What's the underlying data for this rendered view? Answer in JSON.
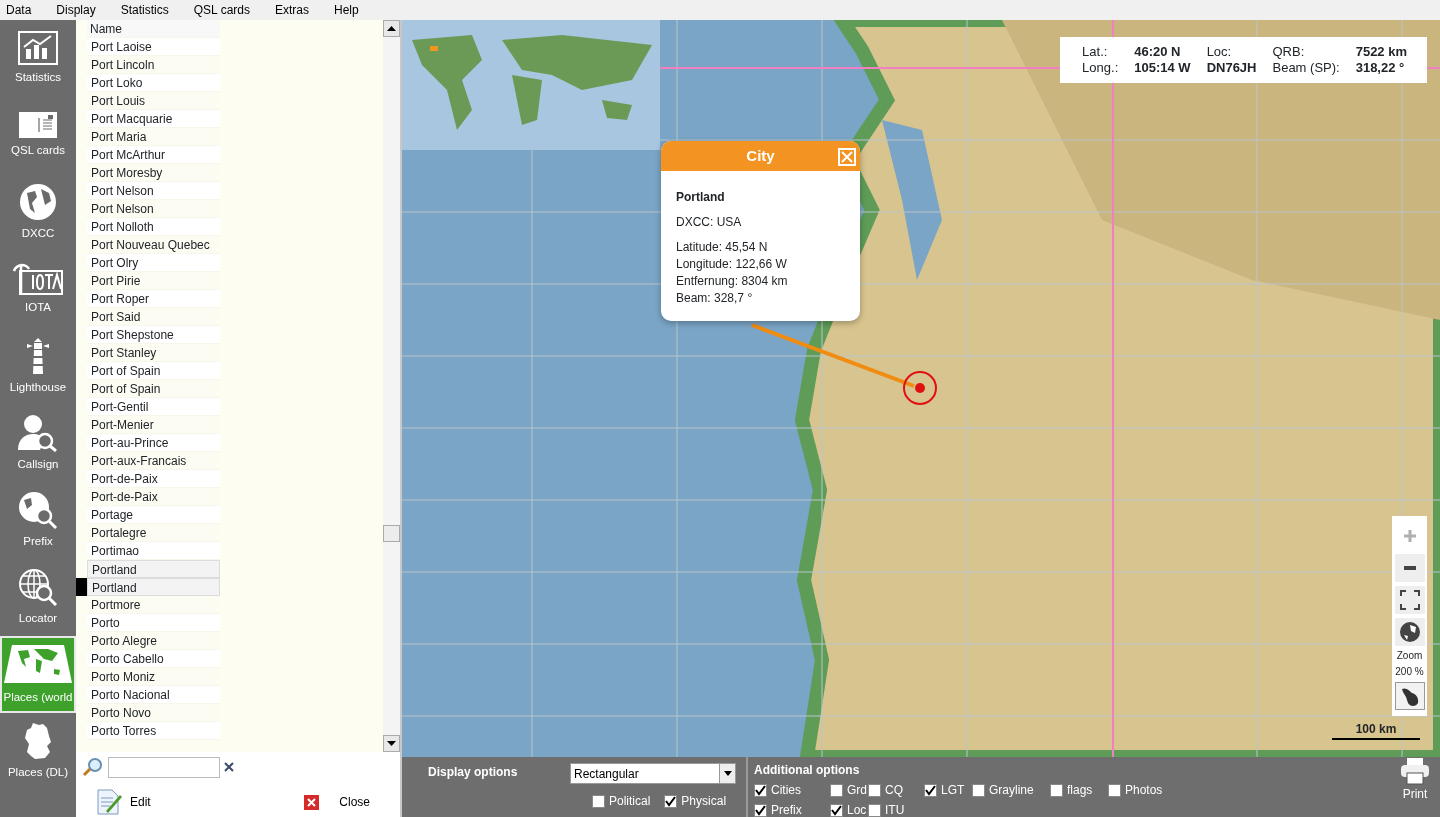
{
  "menu": [
    "Data",
    "Display",
    "Statistics",
    "QSL cards",
    "Extras",
    "Help"
  ],
  "sidebar": [
    {
      "label": "Statistics",
      "kind": "chart",
      "selected": false
    },
    {
      "label": "QSL cards",
      "kind": "card",
      "selected": false
    },
    {
      "label": "DXCC",
      "kind": "globe",
      "selected": false
    },
    {
      "label": "IOTA",
      "kind": "iota",
      "selected": false
    },
    {
      "label": "Lighthouse",
      "kind": "lighthouse",
      "selected": false
    },
    {
      "label": "Callsign",
      "kind": "person",
      "selected": false
    },
    {
      "label": "Prefix",
      "kind": "globe-search",
      "selected": false
    },
    {
      "label": "Locator",
      "kind": "grid-search",
      "selected": false
    },
    {
      "label": "Places (world",
      "kind": "map",
      "selected": true
    },
    {
      "label": "Places (DL)",
      "kind": "germany",
      "selected": false
    }
  ],
  "places_list": {
    "column": "Name",
    "items": [
      {
        "name": "Port Laoise",
        "selected": false,
        "highlighted": false
      },
      {
        "name": "Port Lincoln",
        "selected": false,
        "highlighted": false
      },
      {
        "name": "Port Loko",
        "selected": false,
        "highlighted": false
      },
      {
        "name": "Port Louis",
        "selected": false,
        "highlighted": false
      },
      {
        "name": "Port Macquarie",
        "selected": false,
        "highlighted": false
      },
      {
        "name": "Port Maria",
        "selected": false,
        "highlighted": false
      },
      {
        "name": "Port McArthur",
        "selected": false,
        "highlighted": false
      },
      {
        "name": "Port Moresby",
        "selected": false,
        "highlighted": false
      },
      {
        "name": "Port Nelson",
        "selected": false,
        "highlighted": false
      },
      {
        "name": "Port Nelson",
        "selected": false,
        "highlighted": false
      },
      {
        "name": "Port Nolloth",
        "selected": false,
        "highlighted": false
      },
      {
        "name": "Port Nouveau Quebec",
        "selected": false,
        "highlighted": false
      },
      {
        "name": "Port Olry",
        "selected": false,
        "highlighted": false
      },
      {
        "name": "Port Pirie",
        "selected": false,
        "highlighted": false
      },
      {
        "name": "Port Roper",
        "selected": false,
        "highlighted": false
      },
      {
        "name": "Port Said",
        "selected": false,
        "highlighted": false
      },
      {
        "name": "Port Shepstone",
        "selected": false,
        "highlighted": false
      },
      {
        "name": "Port Stanley",
        "selected": false,
        "highlighted": false
      },
      {
        "name": "Port of Spain",
        "selected": false,
        "highlighted": false
      },
      {
        "name": "Port of Spain",
        "selected": false,
        "highlighted": false
      },
      {
        "name": "Port-Gentil",
        "selected": false,
        "highlighted": false
      },
      {
        "name": "Port-Menier",
        "selected": false,
        "highlighted": false
      },
      {
        "name": "Port-au-Prince",
        "selected": false,
        "highlighted": false
      },
      {
        "name": "Port-aux-Francais",
        "selected": false,
        "highlighted": false
      },
      {
        "name": "Port-de-Paix",
        "selected": false,
        "highlighted": false
      },
      {
        "name": "Port-de-Paix",
        "selected": false,
        "highlighted": false
      },
      {
        "name": "Portage",
        "selected": false,
        "highlighted": false
      },
      {
        "name": "Portalegre",
        "selected": false,
        "highlighted": false
      },
      {
        "name": "Portimao",
        "selected": false,
        "highlighted": false
      },
      {
        "name": "Portland",
        "selected": false,
        "highlighted": true
      },
      {
        "name": "Portland",
        "selected": true,
        "highlighted": true
      },
      {
        "name": "Portmore",
        "selected": false,
        "highlighted": false
      },
      {
        "name": "Porto",
        "selected": false,
        "highlighted": false
      },
      {
        "name": "Porto Alegre",
        "selected": false,
        "highlighted": false
      },
      {
        "name": "Porto Cabello",
        "selected": false,
        "highlighted": false
      },
      {
        "name": "Porto Moniz",
        "selected": false,
        "highlighted": false
      },
      {
        "name": "Porto Nacional",
        "selected": false,
        "highlighted": false
      },
      {
        "name": "Porto Novo",
        "selected": false,
        "highlighted": false
      },
      {
        "name": "Porto Torres",
        "selected": false,
        "highlighted": false
      }
    ]
  },
  "list_buttons": [
    {
      "label": "Edit",
      "kind": "edit"
    },
    {
      "label": "Close",
      "kind": "close"
    }
  ],
  "map": {
    "info": [
      {
        "text": "Lat.:",
        "bold": false
      },
      {
        "text": "46:20 N",
        "bold": true
      },
      {
        "text": "Loc:",
        "bold": false
      },
      {
        "text": "QRB:",
        "bold": false
      },
      {
        "text": "7522 km",
        "bold": true
      },
      {
        "text": "Long.:",
        "bold": false
      },
      {
        "text": "105:14 W",
        "bold": true
      },
      {
        "text": "DN76JH",
        "bold": true
      },
      {
        "text": "Beam (SP):",
        "bold": false
      },
      {
        "text": "318,22 °",
        "bold": true
      }
    ],
    "popup": {
      "title": "City",
      "name": "Portland",
      "dxcc": "DXCC: USA",
      "lines": [
        "Latitude: 45,54 N",
        "Longitude: 122,66 W",
        "Entfernung: 8304 km",
        "Beam: 328,7 °"
      ]
    },
    "zoom_buttons": [
      {
        "kind": "plus",
        "disabled": true
      },
      {
        "kind": "minus",
        "disabled": false
      },
      {
        "kind": "fit",
        "disabled": false
      },
      {
        "kind": "globe",
        "disabled": false
      }
    ],
    "zoom_label": "Zoom",
    "zoom_value": "200 %",
    "scale": "100 km"
  },
  "display_options": {
    "title": "Display options",
    "projection": "Rectangular",
    "checkboxes": [
      {
        "label": "Political",
        "checked": false
      },
      {
        "label": "Physical",
        "checked": true
      }
    ]
  },
  "additional_options": {
    "title": "Additional options",
    "checkboxes": [
      {
        "label": "Cities",
        "checked": true
      },
      {
        "label": "Grd",
        "checked": false
      },
      {
        "label": "CQ",
        "checked": false
      },
      {
        "label": "LGT",
        "checked": true
      },
      {
        "label": "Grayline",
        "checked": false
      },
      {
        "label": "flags",
        "checked": false
      },
      {
        "label": "Photos",
        "checked": false
      },
      {
        "label": "Prefix",
        "checked": true
      },
      {
        "label": "Loc",
        "checked": true
      },
      {
        "label": "ITU",
        "checked": false
      }
    ]
  },
  "print": {
    "label": "Print"
  }
}
